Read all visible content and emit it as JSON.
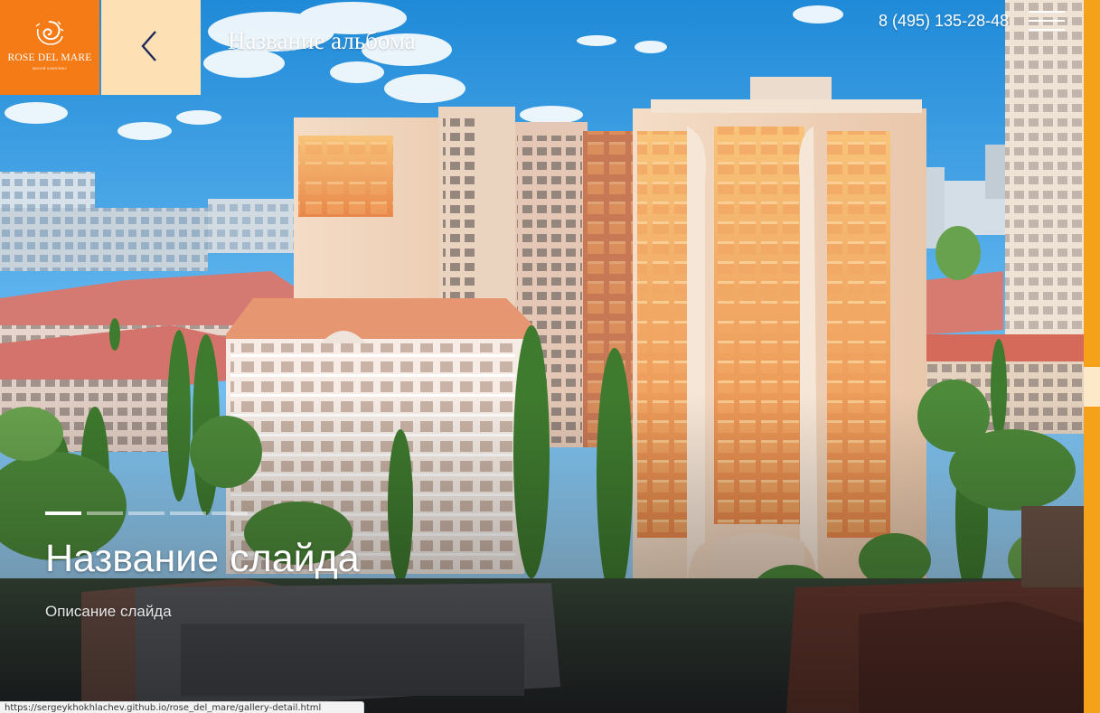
{
  "brand": {
    "name": "ROSE DEL MARE",
    "tagline": "жилой комплекс",
    "logo_icon": "rose-spiral-icon",
    "accent": "#f47b16",
    "accent_light": "#fde0b4"
  },
  "header": {
    "back_icon": "chevron-left-icon",
    "album_title": "Название альбома",
    "phone": "8 (495) 135-28-48",
    "menu_icon": "hamburger-menu-icon"
  },
  "slider": {
    "title": "Название слайда",
    "description": "Описание слайда",
    "slide_count": 5,
    "active_index": 0
  },
  "scrollbar": {
    "color": "#f5a21a",
    "thumb_color": "#fde8c8"
  },
  "status_bar": {
    "url": "https://sergeykhokhlachev.github.io/rose_del_mare/gallery-detail.html"
  }
}
